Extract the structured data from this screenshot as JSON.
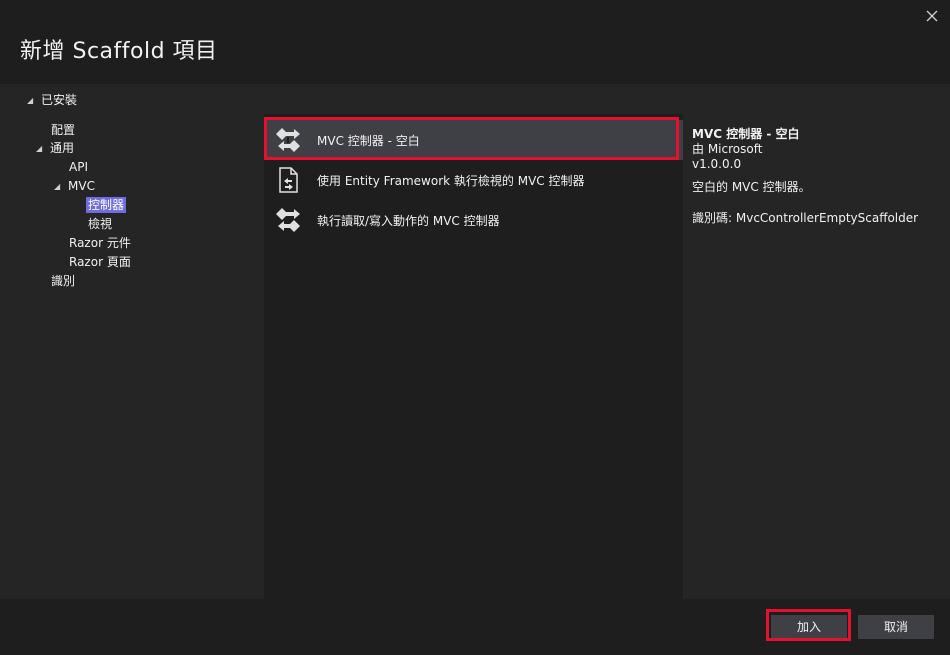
{
  "dialog": {
    "title": "新增 Scaffold 項目"
  },
  "tree": {
    "installed": "已安裝",
    "items": [
      {
        "label": "配置"
      },
      {
        "label": "通用"
      },
      {
        "label": "API"
      },
      {
        "label": "MVC"
      },
      {
        "label": "控制器"
      },
      {
        "label": "檢視"
      },
      {
        "label": "Razor 元件"
      },
      {
        "label": "Razor 頁面"
      },
      {
        "label": "識別"
      }
    ]
  },
  "templates": [
    {
      "name": "MVC 控制器 - 空白",
      "icon": "controller-icon"
    },
    {
      "name": "使用 Entity Framework 執行檢視的 MVC 控制器",
      "icon": "document-controller-icon"
    },
    {
      "name": "執行讀取/寫入動作的 MVC 控制器",
      "icon": "controller-icon"
    }
  ],
  "details": {
    "title": "MVC 控制器 - 空白",
    "author": "由 Microsoft",
    "version": "v1.0.0.0",
    "description": "空白的 MVC 控制器。",
    "id": "識別碼: MvcControllerEmptyScaffolder"
  },
  "buttons": {
    "add": "加入",
    "cancel": "取消"
  },
  "colors": {
    "selection": "#6f6cdf",
    "highlight": "#e8112d"
  }
}
